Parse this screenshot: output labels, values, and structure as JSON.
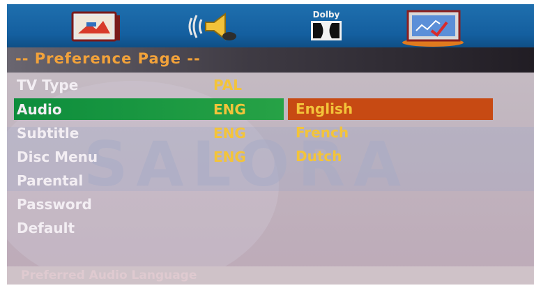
{
  "icons": [
    {
      "name": "general-setup-icon",
      "label": ""
    },
    {
      "name": "audio-setup-icon",
      "label": ""
    },
    {
      "name": "dolby-setup-icon",
      "label": "Dolby"
    },
    {
      "name": "preference-setup-icon",
      "label": ""
    }
  ],
  "header": {
    "title": "-- Preference Page --"
  },
  "rows": [
    {
      "label": "TV Type",
      "value": "PAL"
    },
    {
      "label": "Audio",
      "value": "ENG"
    },
    {
      "label": "Subtitle",
      "value": "ENG"
    },
    {
      "label": "Disc Menu",
      "value": "ENG"
    },
    {
      "label": "Parental",
      "value": ""
    },
    {
      "label": "Password",
      "value": ""
    },
    {
      "label": "Default",
      "value": ""
    }
  ],
  "options": [
    {
      "label": "English",
      "selected": true
    },
    {
      "label": "French",
      "selected": false
    },
    {
      "label": "Dutch",
      "selected": false
    }
  ],
  "watermark": "SALORA",
  "status": {
    "text": "Preferred Audio Language"
  },
  "colors": {
    "icon_bar": "#145f9f",
    "selection_green": "#1a9a42",
    "selection_orange": "#c74a13",
    "value_text": "#f3c43a",
    "title_text": "#f2a23a"
  }
}
